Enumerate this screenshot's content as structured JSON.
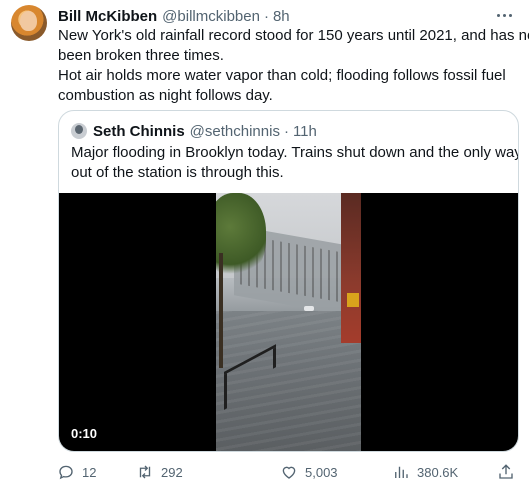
{
  "tweet": {
    "author_name": "Bill McKibben",
    "author_handle": "@billmckibben",
    "separator": "·",
    "time": "8h",
    "text_lines": [
      "New York's old rainfall record stood for 150 years until 2021, and has now",
      "been broken three times.",
      "Hot air holds more water vapor than cold; flooding follows fossil fuel",
      "combustion as night follows day."
    ]
  },
  "quote": {
    "author_name": "Seth Chinnis",
    "author_handle": "@sethchinnis",
    "separator": "·",
    "time": "11h",
    "text_lines": [
      "Major flooding in Brooklyn today. Trains shut down and the only way",
      "out of the station is through this."
    ],
    "video_timestamp": "0:10"
  },
  "actions": {
    "replies": "12",
    "retweets": "292",
    "likes": "5,003",
    "views": "380.6K"
  },
  "icons": {
    "reply": "reply-bubble-icon",
    "retweet": "retweet-arrows-icon",
    "like": "heart-icon",
    "views": "views-bar-chart-icon",
    "share": "share-upload-icon",
    "more": "more-dots-icon"
  },
  "colors": {
    "text_primary": "#0f1419",
    "text_secondary": "#536471",
    "border": "#cfd9de"
  }
}
